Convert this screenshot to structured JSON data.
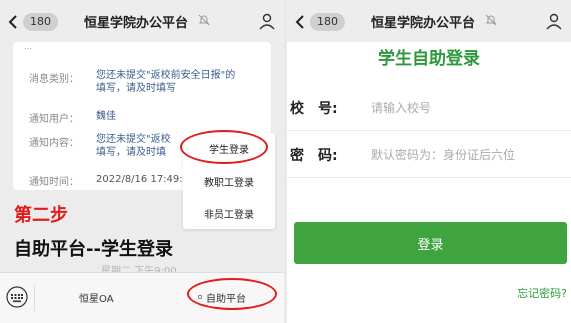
{
  "left": {
    "nav": {
      "badge": "180",
      "title": "恒星学院办公平台"
    },
    "card": {
      "cut_text": "...",
      "rows": [
        {
          "label": "消息类别：",
          "value_lines": [
            "您还未提交\"返校前安全日报\"的",
            "填写，请及时填写"
          ]
        },
        {
          "label": "通知用户：",
          "value_lines": [
            "魏佳"
          ]
        },
        {
          "label": "通知内容：",
          "value_lines": [
            "您还未提交\"返校",
            "填写，请及时填"
          ]
        },
        {
          "label": "通知时间：",
          "value_lines": [
            "2022/8/16 17:49:"
          ]
        }
      ]
    },
    "step_label": "第二步",
    "headline": "自助平台--学生登录",
    "faded_time": "星期二 下午9:00",
    "menu": [
      "学生登录",
      "教职工登录",
      "非员工登录"
    ],
    "bottom_bar": {
      "tab1": "恒星OA",
      "tab2": "自助平台"
    }
  },
  "right": {
    "nav": {
      "badge": "180",
      "title": "恒星学院办公平台"
    },
    "title": "学生自助登录",
    "fields": [
      {
        "label_a": "校",
        "label_b": "号:",
        "placeholder": "请输入校号"
      },
      {
        "label_a": "密",
        "label_b": "码:",
        "placeholder": "默认密码为：身份证后六位"
      }
    ],
    "login_label": "登录",
    "forgot_label": "忘记密码?"
  },
  "colors": {
    "accent_green": "#3fa33f",
    "highlight_red": "#e21b1b",
    "link_blue": "#3c5b8c"
  },
  "icons": [
    "back-chevron-icon",
    "mute-bell-icon",
    "user-icon",
    "keyboard-icon"
  ]
}
